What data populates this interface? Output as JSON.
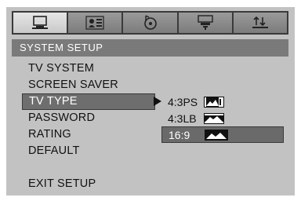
{
  "tabs": [
    {
      "icon": "monitor-icon",
      "active": true
    },
    {
      "icon": "speaker-icon",
      "active": false
    },
    {
      "icon": "audio-disc-icon",
      "active": false
    },
    {
      "icon": "video-settings-icon",
      "active": false
    },
    {
      "icon": "equalizer-icon",
      "active": false
    }
  ],
  "section": {
    "title": "SYSTEM SETUP"
  },
  "menu": {
    "tv_system": "TV SYSTEM",
    "screen_saver": "SCREEN SAVER",
    "tv_type": "TV TYPE",
    "password": "PASSWORD",
    "rating": "RATING",
    "default": "DEFAULT",
    "exit_setup": "EXIT SETUP",
    "selected": "TV TYPE"
  },
  "options": {
    "ps": "4:3PS",
    "lb": "4:3LB",
    "wide": "16:9",
    "highlighted": "16:9"
  },
  "colors": {
    "background": "#c2c2c2",
    "header": "#7a7a7a",
    "selection": "#6e6e6e",
    "text": "#111111"
  }
}
